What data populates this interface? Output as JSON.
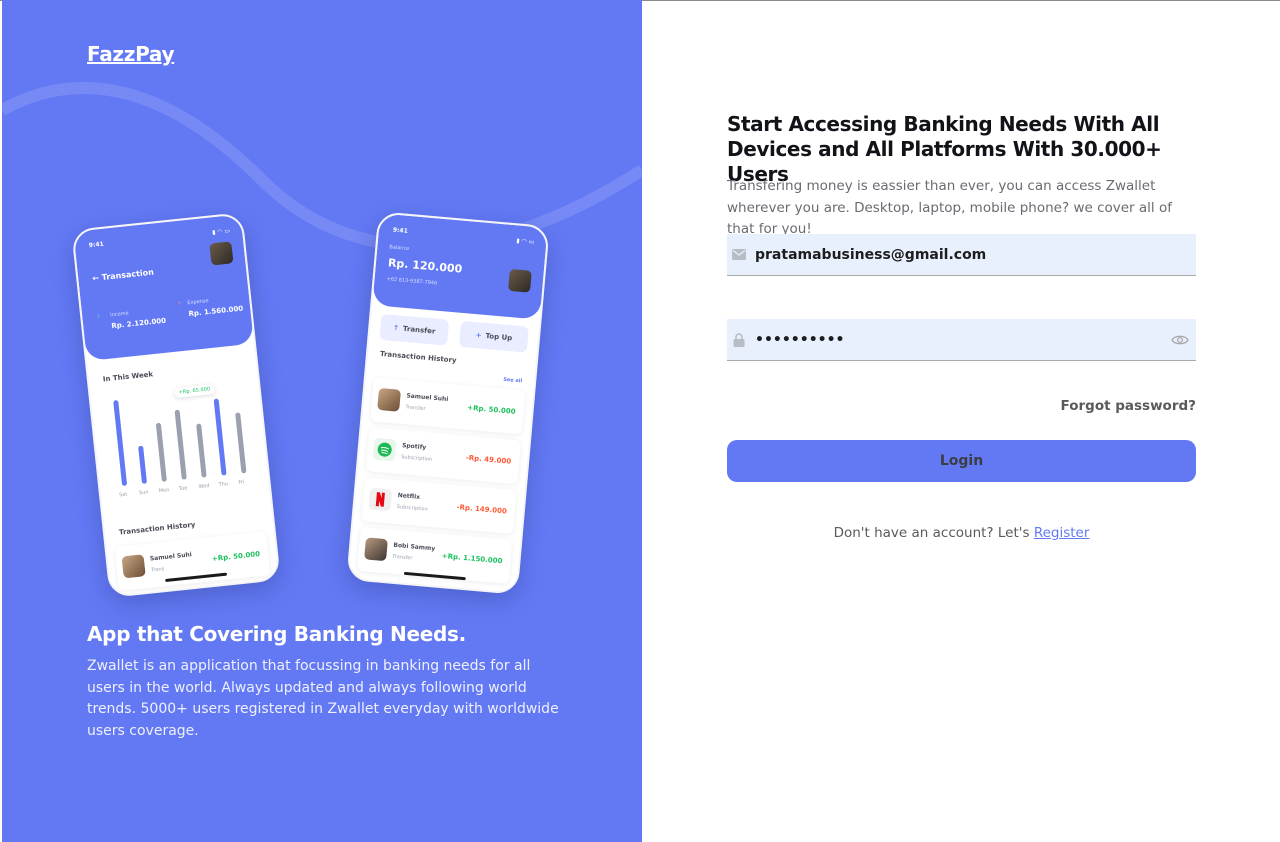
{
  "brand": "FazzPay",
  "left": {
    "title": "App that Covering Banking Needs.",
    "description": "Zwallet is an application that focussing in banking needs for all users in the world. Always updated and always following world trends. 5000+ users registered in Zwallet everyday with worldwide users coverage."
  },
  "phone1": {
    "time": "9:41",
    "title": "Transaction",
    "income_label": "Income",
    "income_value": "Rp. 2.120.000",
    "expense_label": "Expense",
    "expense_value": "Rp. 1.560.000",
    "week_title": "In This Week",
    "tooltip": "+Rp. 65.000",
    "days": [
      "Sat",
      "Sun",
      "Mon",
      "Tue",
      "Wed",
      "Thu",
      "Fri"
    ],
    "bar_levels": [
      0.95,
      0.42,
      0.65,
      0.78,
      0.6,
      0.85,
      0.68
    ],
    "history_title": "Transaction History",
    "row_name": "Samuel Suhi",
    "row_sub": "Trans",
    "row_amount": "+Rp. 50.000"
  },
  "phone2": {
    "time": "9:41",
    "balance_label": "Balance",
    "balance": "Rp. 120.000",
    "phone_number": "+62 813-9387-7946",
    "transfer": "Transfer",
    "topup": "Top Up",
    "history_title": "Transaction History",
    "see_all": "See all",
    "rows": [
      {
        "name": "Samuel Suhi",
        "sub": "Transfer",
        "amount": "+Rp. 50.000"
      },
      {
        "name": "Spotify",
        "sub": "Subscription",
        "amount": "-Rp. 49.000"
      },
      {
        "name": "Netflix",
        "sub": "Subscription",
        "amount": "-Rp. 149.000"
      },
      {
        "name": "Bobi Sammy",
        "sub": "Transfer",
        "amount": "+Rp. 1.150.000"
      }
    ]
  },
  "form": {
    "title": "Start Accessing Banking Needs With All Devices and All Platforms With 30.000+ Users",
    "description": "Transfering money is eassier than ever, you can access Zwallet wherever you are. Desktop, laptop, mobile phone? we cover all of that for you!",
    "email_value": "pratamabusiness@gmail.com",
    "password_value": "••••••••••",
    "forgot": "Forgot password?",
    "login": "Login",
    "signup_text": "Don't have an account? Let's",
    "signup_link": "Register"
  },
  "colors": {
    "primary": "#6379f4",
    "income": "#1ec15f",
    "expense": "#ff5b37",
    "field_bg": "#e8f0fe"
  }
}
